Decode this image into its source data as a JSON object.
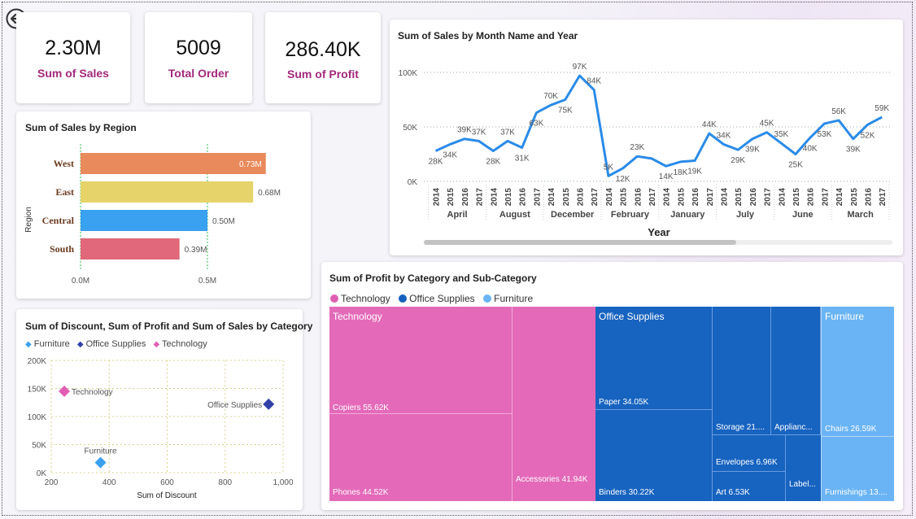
{
  "kpis": [
    {
      "value": "2.30M",
      "label": "Sum of Sales"
    },
    {
      "value": "5009",
      "label": "Total Order"
    },
    {
      "value": "286.40K",
      "label": "Sum of Profit"
    }
  ],
  "region_chart": {
    "title": "Sum of Sales by Region",
    "ylabel": "Region",
    "bars": [
      {
        "name": "West",
        "value": 0.73,
        "label": "0.73M",
        "color": "#e98a5c"
      },
      {
        "name": "East",
        "value": 0.68,
        "label": "0.68M",
        "color": "#e6d36a"
      },
      {
        "name": "Central",
        "value": 0.5,
        "label": "0.50M",
        "color": "#3aa0f0"
      },
      {
        "name": "South",
        "value": 0.39,
        "label": "0.39M",
        "color": "#e0687a"
      }
    ],
    "xticks": [
      "0.0M",
      "0.5M"
    ]
  },
  "line_chart": {
    "title": "Sum of Sales by Month Name and Year",
    "xlabel": "Year",
    "yticks": [
      "100K",
      "50K",
      "0K"
    ],
    "months": [
      "April",
      "August",
      "December",
      "February",
      "January",
      "July",
      "June",
      "March"
    ],
    "years": [
      "2014",
      "2015",
      "2016",
      "2017"
    ],
    "values": [
      28,
      34,
      39,
      37,
      28,
      37,
      31,
      63,
      70,
      75,
      97,
      84,
      5,
      12,
      23,
      21,
      14,
      18,
      19,
      44,
      34,
      29,
      39,
      45,
      35,
      25,
      40,
      53,
      56,
      39,
      52,
      59
    ],
    "labels": [
      "28K",
      "34K",
      "39K",
      "37K",
      "28K",
      "37K",
      "31K",
      "63K",
      "70K",
      "75K",
      "97K",
      "84K",
      "5K",
      "12K",
      "23K",
      "",
      "14K",
      "18K",
      "19K",
      "44K",
      "34K",
      "29K",
      "39K",
      "45K",
      "35K",
      "25K",
      "40K",
      "53K",
      "56K",
      "39K",
      "52K",
      "59K"
    ],
    "color": "#2a8be8"
  },
  "scatter_chart": {
    "title": "Sum of Discount, Sum of Profit and Sum of Sales by Category",
    "legend": [
      {
        "name": "Furniture",
        "color": "#3aa0f0"
      },
      {
        "name": "Office Supplies",
        "color": "#3340a8"
      },
      {
        "name": "Technology",
        "color": "#e05fb3"
      }
    ],
    "xlabel": "Sum of Discount",
    "yticks": [
      "200K",
      "150K",
      "100K",
      "50K",
      "0K"
    ],
    "xticks": [
      "200",
      "400",
      "600",
      "800",
      "1,000"
    ],
    "points": [
      {
        "name": "Technology",
        "x": 245,
        "y": 145000,
        "color": "#e05fb3"
      },
      {
        "name": "Office Supplies",
        "x": 950,
        "y": 122000,
        "color": "#3340a8"
      },
      {
        "name": "Furniture",
        "x": 370,
        "y": 18000,
        "color": "#3aa0f0"
      }
    ]
  },
  "treemap": {
    "title": "Sum of Profit by Category and Sub-Category",
    "legend": [
      {
        "name": "Technology",
        "color": "#e05fb3"
      },
      {
        "name": "Office Supplies",
        "color": "#1560bd"
      },
      {
        "name": "Furniture",
        "color": "#6ab4f5"
      }
    ],
    "categories": {
      "technology": "Technology",
      "office": "Office Supplies",
      "furniture": "Furniture"
    },
    "cells": {
      "copiers": "Copiers 55.62K",
      "phones": "Phones 44.52K",
      "accessories": "Accessories 41.94K",
      "paper": "Paper 34.05K",
      "binders": "Binders 30.22K",
      "storage": "Storage 21....",
      "appliances": "Applianc...",
      "envelopes": "Envelopes 6.96K",
      "art": "Art 6.53K",
      "labels": "Label...",
      "chairs": "Chairs 26.59K",
      "furnishings": "Furnishings 13...."
    }
  }
}
